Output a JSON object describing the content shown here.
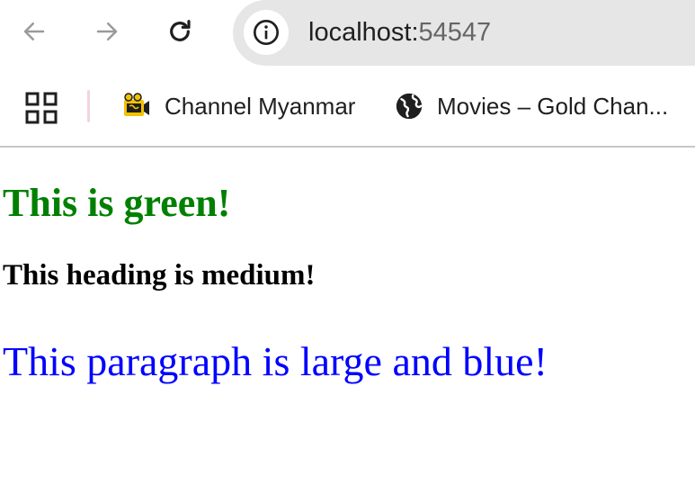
{
  "browser": {
    "url_host": "localhost:",
    "url_port": "54547",
    "bookmarks": [
      {
        "label": "Channel Myanmar",
        "icon": "channel-myanmar-logo-icon"
      },
      {
        "label": "Movies – Gold Chan...",
        "icon": "globe-icon"
      }
    ],
    "bookmark_divider_color": "#f3d3dc"
  },
  "page": {
    "heading_green": {
      "text": "This is green!",
      "color": "#008000"
    },
    "heading_medium": {
      "text": "This heading is medium!",
      "color": "#000000"
    },
    "paragraph_blue": {
      "text": "This paragraph is large and blue!",
      "color": "#0000ff"
    }
  }
}
